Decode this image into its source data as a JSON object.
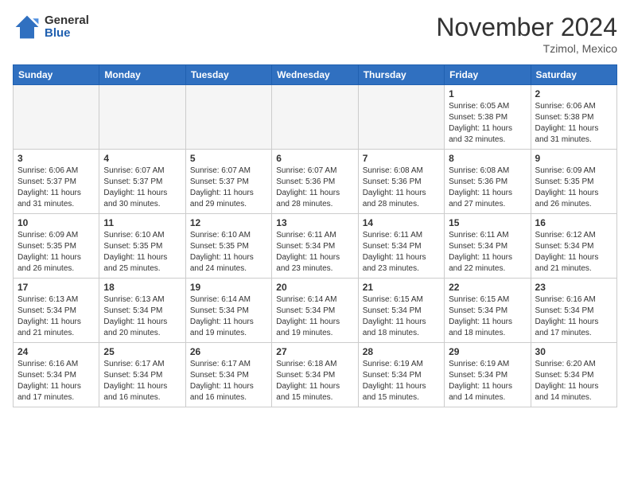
{
  "header": {
    "logo_general": "General",
    "logo_blue": "Blue",
    "month_title": "November 2024",
    "location": "Tzimol, Mexico"
  },
  "weekdays": [
    "Sunday",
    "Monday",
    "Tuesday",
    "Wednesday",
    "Thursday",
    "Friday",
    "Saturday"
  ],
  "weeks": [
    [
      {
        "day": "",
        "empty": true
      },
      {
        "day": "",
        "empty": true
      },
      {
        "day": "",
        "empty": true
      },
      {
        "day": "",
        "empty": true
      },
      {
        "day": "",
        "empty": true
      },
      {
        "day": "1",
        "sunrise": "6:05 AM",
        "sunset": "5:38 PM",
        "daylight": "11 hours and 32 minutes."
      },
      {
        "day": "2",
        "sunrise": "6:06 AM",
        "sunset": "5:38 PM",
        "daylight": "11 hours and 31 minutes."
      }
    ],
    [
      {
        "day": "3",
        "sunrise": "6:06 AM",
        "sunset": "5:37 PM",
        "daylight": "11 hours and 31 minutes."
      },
      {
        "day": "4",
        "sunrise": "6:07 AM",
        "sunset": "5:37 PM",
        "daylight": "11 hours and 30 minutes."
      },
      {
        "day": "5",
        "sunrise": "6:07 AM",
        "sunset": "5:37 PM",
        "daylight": "11 hours and 29 minutes."
      },
      {
        "day": "6",
        "sunrise": "6:07 AM",
        "sunset": "5:36 PM",
        "daylight": "11 hours and 28 minutes."
      },
      {
        "day": "7",
        "sunrise": "6:08 AM",
        "sunset": "5:36 PM",
        "daylight": "11 hours and 28 minutes."
      },
      {
        "day": "8",
        "sunrise": "6:08 AM",
        "sunset": "5:36 PM",
        "daylight": "11 hours and 27 minutes."
      },
      {
        "day": "9",
        "sunrise": "6:09 AM",
        "sunset": "5:35 PM",
        "daylight": "11 hours and 26 minutes."
      }
    ],
    [
      {
        "day": "10",
        "sunrise": "6:09 AM",
        "sunset": "5:35 PM",
        "daylight": "11 hours and 26 minutes."
      },
      {
        "day": "11",
        "sunrise": "6:10 AM",
        "sunset": "5:35 PM",
        "daylight": "11 hours and 25 minutes."
      },
      {
        "day": "12",
        "sunrise": "6:10 AM",
        "sunset": "5:35 PM",
        "daylight": "11 hours and 24 minutes."
      },
      {
        "day": "13",
        "sunrise": "6:11 AM",
        "sunset": "5:34 PM",
        "daylight": "11 hours and 23 minutes."
      },
      {
        "day": "14",
        "sunrise": "6:11 AM",
        "sunset": "5:34 PM",
        "daylight": "11 hours and 23 minutes."
      },
      {
        "day": "15",
        "sunrise": "6:11 AM",
        "sunset": "5:34 PM",
        "daylight": "11 hours and 22 minutes."
      },
      {
        "day": "16",
        "sunrise": "6:12 AM",
        "sunset": "5:34 PM",
        "daylight": "11 hours and 21 minutes."
      }
    ],
    [
      {
        "day": "17",
        "sunrise": "6:13 AM",
        "sunset": "5:34 PM",
        "daylight": "11 hours and 21 minutes."
      },
      {
        "day": "18",
        "sunrise": "6:13 AM",
        "sunset": "5:34 PM",
        "daylight": "11 hours and 20 minutes."
      },
      {
        "day": "19",
        "sunrise": "6:14 AM",
        "sunset": "5:34 PM",
        "daylight": "11 hours and 19 minutes."
      },
      {
        "day": "20",
        "sunrise": "6:14 AM",
        "sunset": "5:34 PM",
        "daylight": "11 hours and 19 minutes."
      },
      {
        "day": "21",
        "sunrise": "6:15 AM",
        "sunset": "5:34 PM",
        "daylight": "11 hours and 18 minutes."
      },
      {
        "day": "22",
        "sunrise": "6:15 AM",
        "sunset": "5:34 PM",
        "daylight": "11 hours and 18 minutes."
      },
      {
        "day": "23",
        "sunrise": "6:16 AM",
        "sunset": "5:34 PM",
        "daylight": "11 hours and 17 minutes."
      }
    ],
    [
      {
        "day": "24",
        "sunrise": "6:16 AM",
        "sunset": "5:34 PM",
        "daylight": "11 hours and 17 minutes."
      },
      {
        "day": "25",
        "sunrise": "6:17 AM",
        "sunset": "5:34 PM",
        "daylight": "11 hours and 16 minutes."
      },
      {
        "day": "26",
        "sunrise": "6:17 AM",
        "sunset": "5:34 PM",
        "daylight": "11 hours and 16 minutes."
      },
      {
        "day": "27",
        "sunrise": "6:18 AM",
        "sunset": "5:34 PM",
        "daylight": "11 hours and 15 minutes."
      },
      {
        "day": "28",
        "sunrise": "6:19 AM",
        "sunset": "5:34 PM",
        "daylight": "11 hours and 15 minutes."
      },
      {
        "day": "29",
        "sunrise": "6:19 AM",
        "sunset": "5:34 PM",
        "daylight": "11 hours and 14 minutes."
      },
      {
        "day": "30",
        "sunrise": "6:20 AM",
        "sunset": "5:34 PM",
        "daylight": "11 hours and 14 minutes."
      }
    ]
  ],
  "labels": {
    "sunrise": "Sunrise:",
    "sunset": "Sunset:",
    "daylight": "Daylight:"
  }
}
